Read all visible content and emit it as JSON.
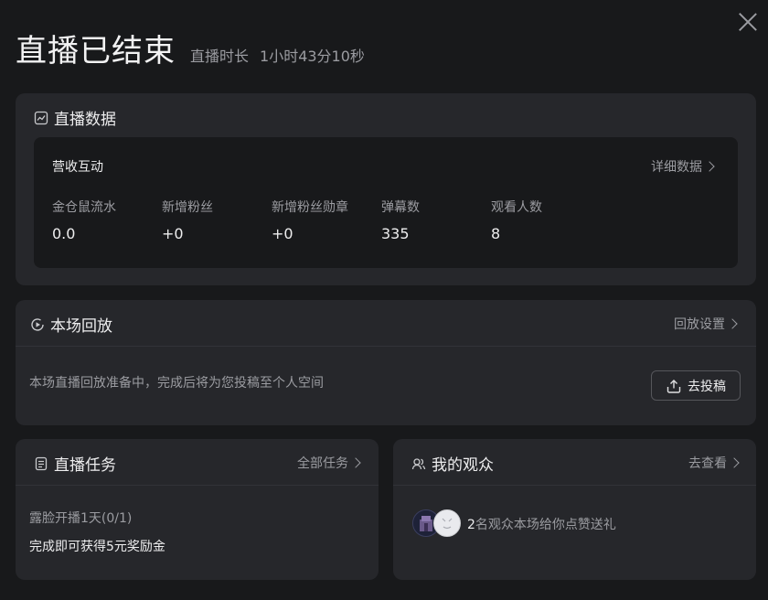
{
  "header": {
    "title": "直播已结束",
    "duration_label": "直播时长",
    "duration_value": "1小时43分10秒"
  },
  "live_data": {
    "title": "直播数据",
    "icon": "chart-line-icon",
    "section": "营收互动",
    "detail_link": "详细数据",
    "stats": [
      {
        "label": "金仓鼠流水",
        "value": "0.0"
      },
      {
        "label": "新增粉丝",
        "value": "+0"
      },
      {
        "label": "新增粉丝勋章",
        "value": "+0"
      },
      {
        "label": "弹幕数",
        "value": "335"
      },
      {
        "label": "观看人数",
        "value": "8"
      }
    ]
  },
  "replay": {
    "title": "本场回放",
    "icon": "play-circle-icon",
    "settings_link": "回放设置",
    "message": "本场直播回放准备中，完成后将为您投稿至个人空间",
    "upload_button": "去投稿"
  },
  "tasks": {
    "title": "直播任务",
    "icon": "document-icon",
    "all_link": "全部任务",
    "task_name": "露脸开播1天(0/1)",
    "reward": "完成即可获得5元奖励金"
  },
  "audience": {
    "title": "我的观众",
    "icon": "people-icon",
    "link": "去查看",
    "count": "2",
    "message": "名观众本场给你点赞送礼"
  }
}
